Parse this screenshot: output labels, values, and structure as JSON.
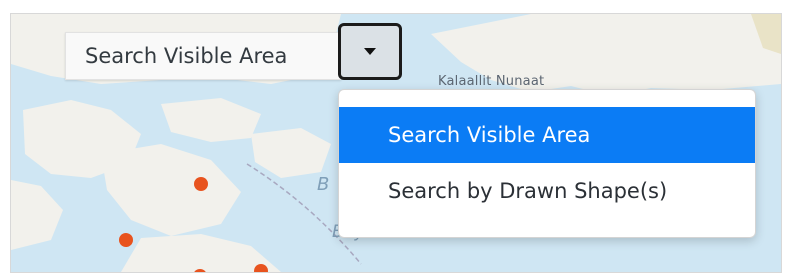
{
  "map": {
    "labels": [
      "Kalaallit Nunaat",
      "B",
      "Bay"
    ],
    "water_color": "#cfe6f3",
    "land_color": "#f2f1ec",
    "marker_color": "#e8531e"
  },
  "search_control": {
    "selected_value": "Search Visible Area",
    "toggle_icon": "caret-down-icon",
    "options": [
      {
        "label": "Search Visible Area",
        "active": true
      },
      {
        "label": "Search by Drawn Shape(s)",
        "active": false
      }
    ],
    "active_color": "#0b7cf5"
  }
}
